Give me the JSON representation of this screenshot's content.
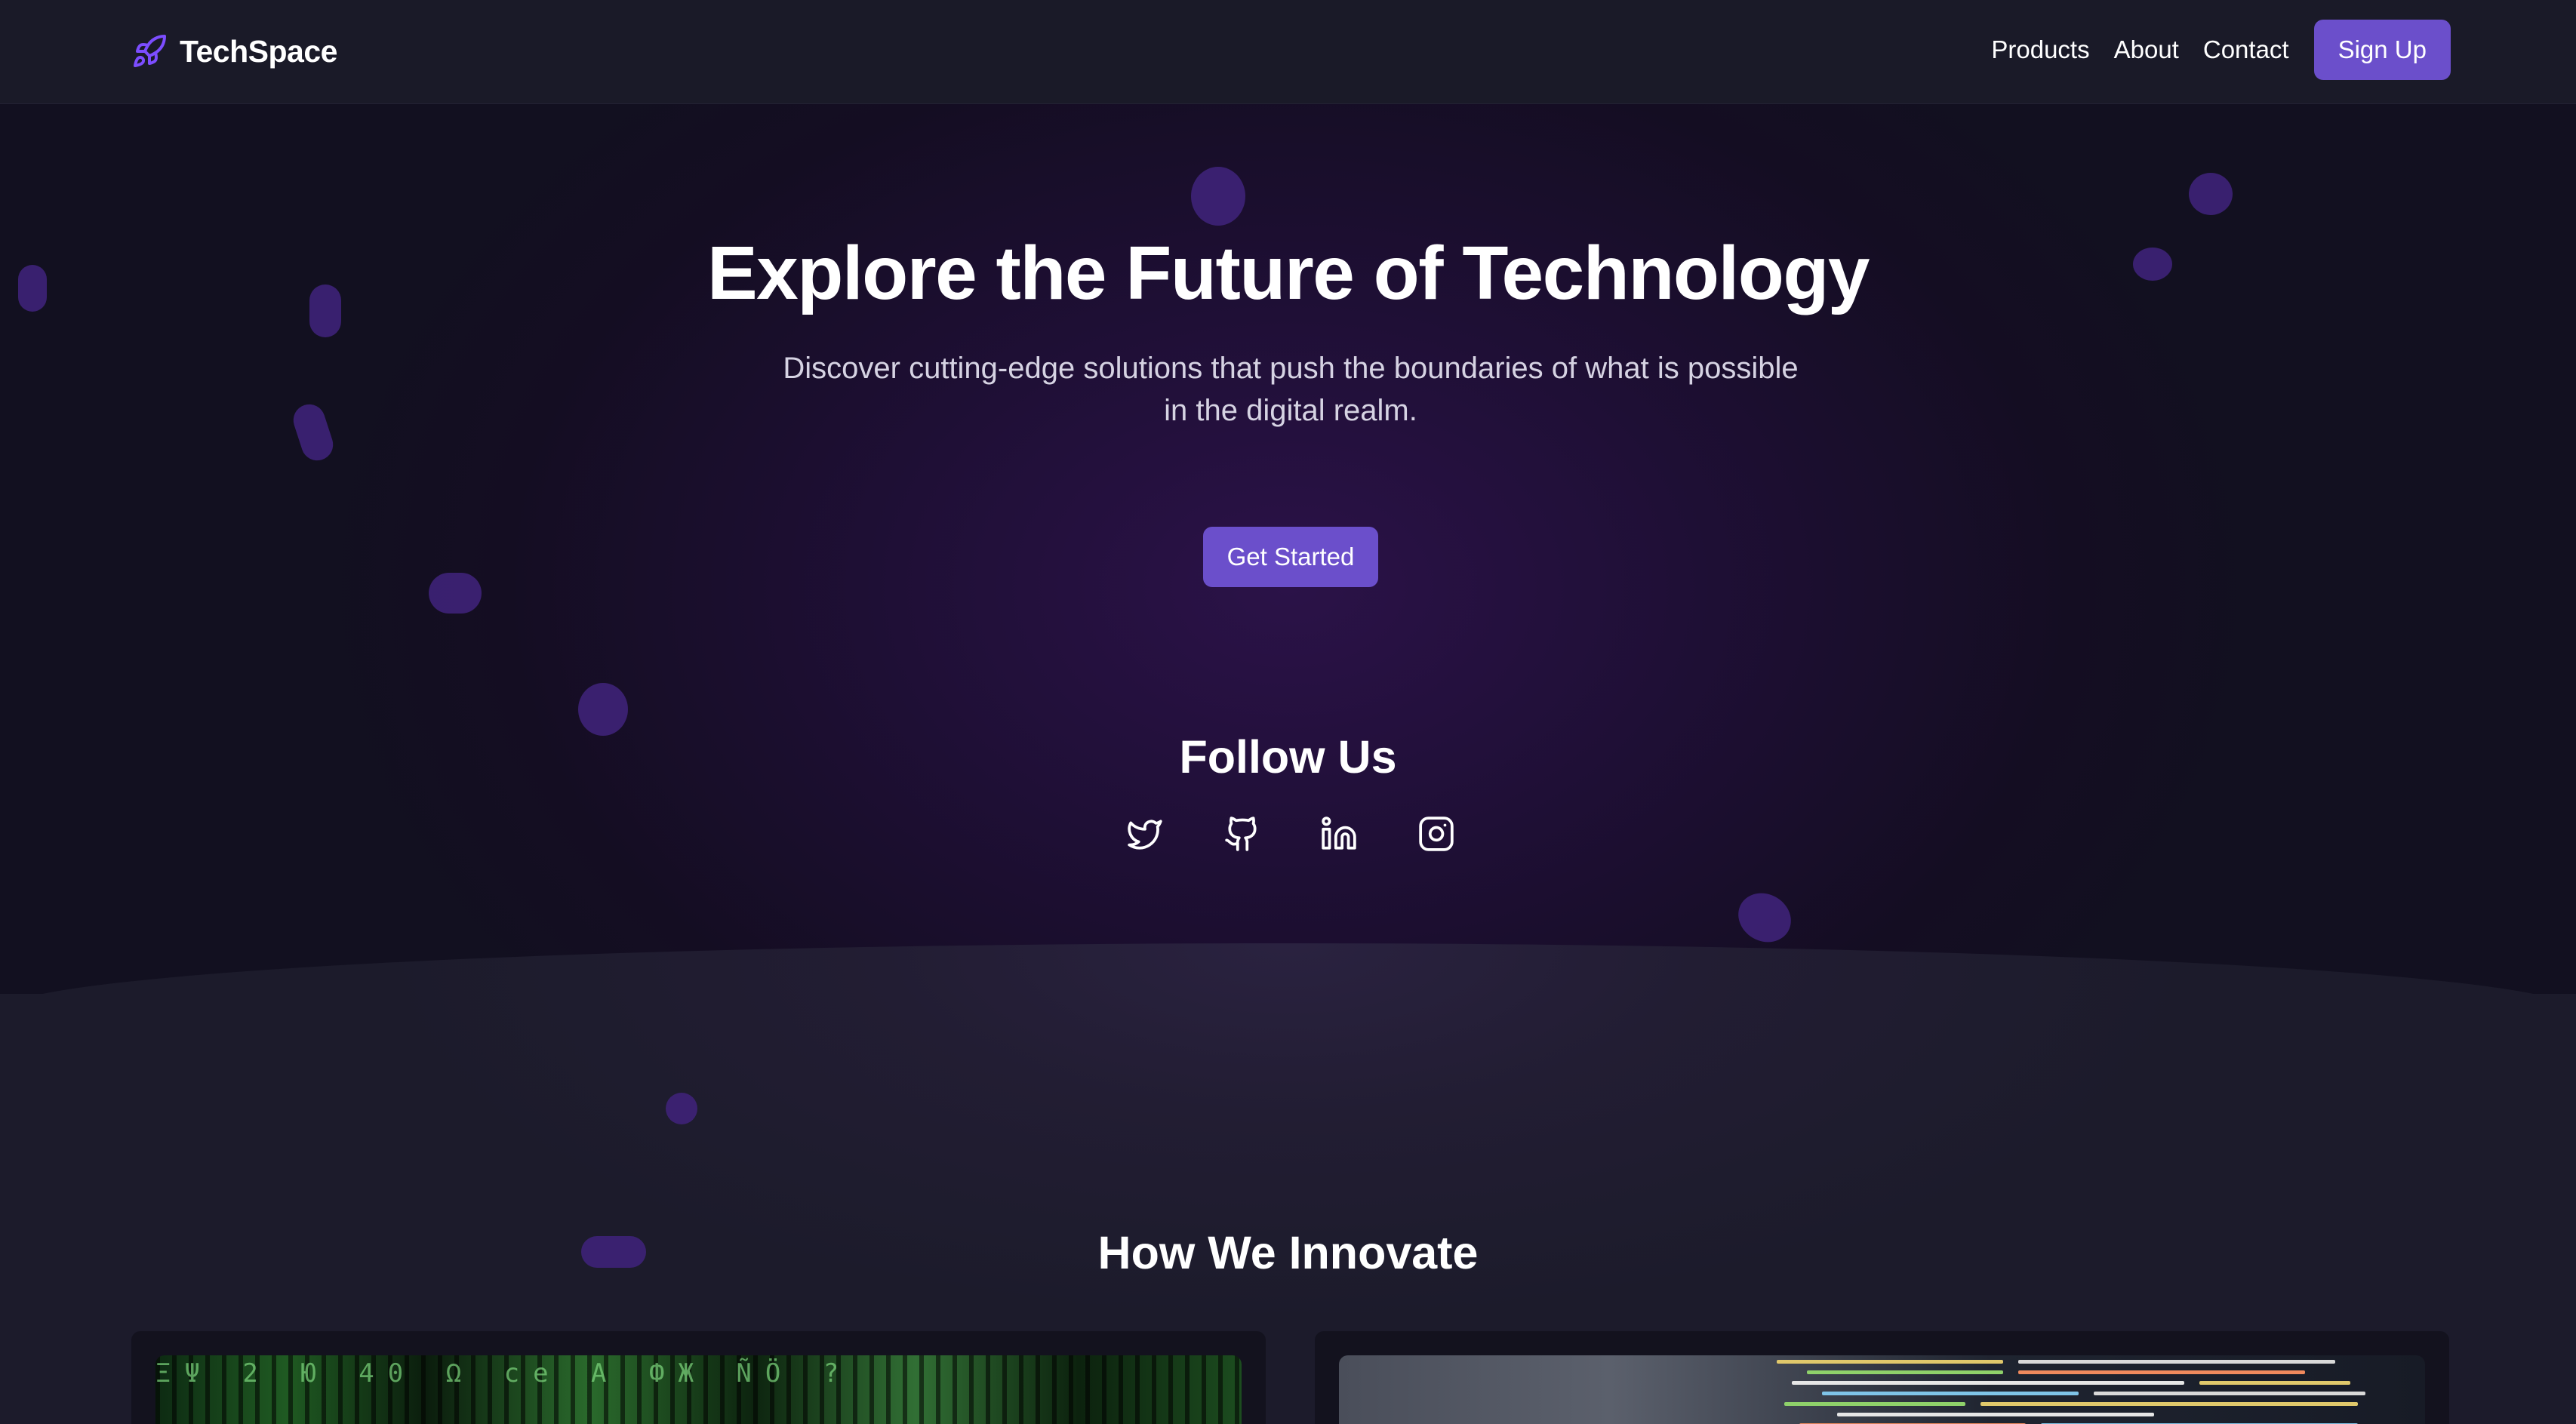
{
  "brand": {
    "name": "TechSpace",
    "icon": "rocket-icon",
    "accent": "#7c4dff"
  },
  "nav": {
    "links": [
      "Products",
      "About",
      "Contact"
    ],
    "cta": "Sign Up"
  },
  "hero": {
    "title": "Explore the Future of Technology",
    "subtitle": "Discover cutting-edge solutions that push the boundaries of what is possible in the digital realm.",
    "cta": "Get Started"
  },
  "follow": {
    "title": "Follow Us",
    "icons": [
      "twitter-icon",
      "github-icon",
      "linkedin-icon",
      "instagram-icon"
    ]
  },
  "innovate": {
    "title": "How We Innovate",
    "cards": [
      {
        "image": "matrix-code-image",
        "image_text": "ΞΨ 2 Ю 40 Ω ce A ФЖ ÑÖ ?"
      },
      {
        "image": "code-editor-image"
      }
    ]
  },
  "colors": {
    "primary_button": "#6b4fcb",
    "nav_background": "#1a1a28",
    "hero_glow": "#2b1248",
    "blob": "#3e2278"
  }
}
